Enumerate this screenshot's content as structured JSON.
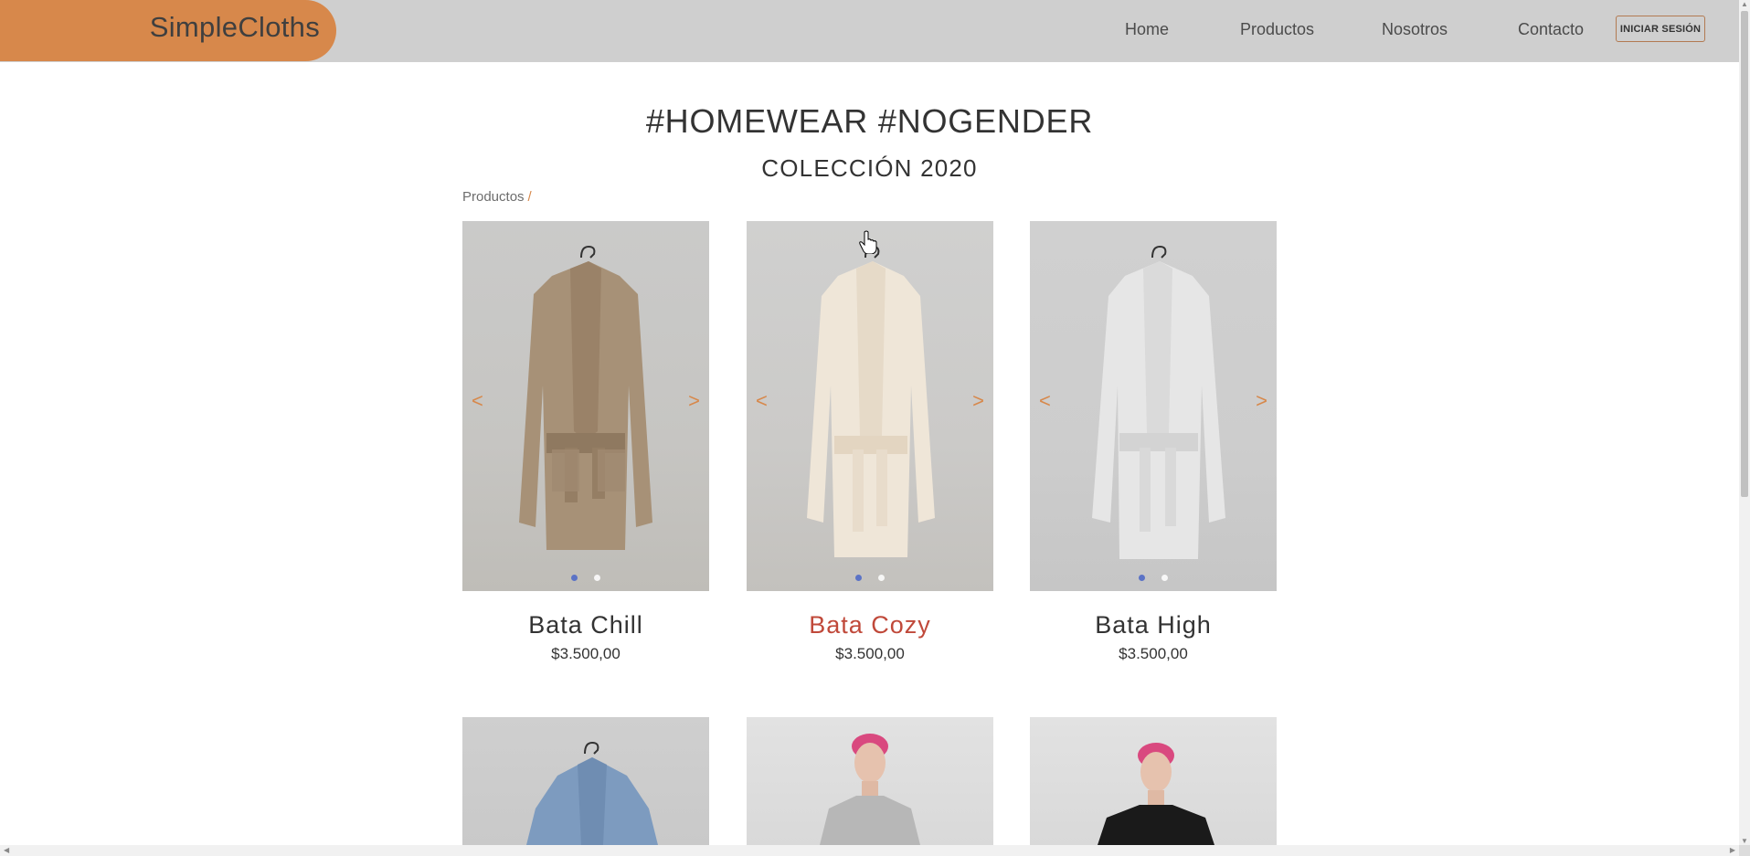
{
  "header": {
    "logo": "SimpleCloths",
    "nav": {
      "home": "Home",
      "products": "Productos",
      "about": "Nosotros",
      "contact": "Contacto"
    },
    "login": "INICIAR SESIÓN"
  },
  "hero": {
    "title": "#HOMEWEAR #NOGENDER",
    "subtitle": "COLECCIÓN 2020"
  },
  "breadcrumb": {
    "items": [
      "Productos"
    ],
    "separator": "/"
  },
  "carousel": {
    "prev": "<",
    "next": ">"
  },
  "products": [
    {
      "name": "Bata Chill",
      "price": "$3.500,00",
      "slides": 2,
      "active_slide": 1
    },
    {
      "name": "Bata Cozy",
      "price": "$3.500,00",
      "slides": 2,
      "active_slide": 1,
      "hovered": true
    },
    {
      "name": "Bata High",
      "price": "$3.500,00",
      "slides": 2,
      "active_slide": 1
    }
  ],
  "colors": {
    "accent": "#d7884b",
    "header_bg": "#cfcfcf",
    "hover_text": "#c0493a",
    "active_dot": "#5b73c6"
  }
}
